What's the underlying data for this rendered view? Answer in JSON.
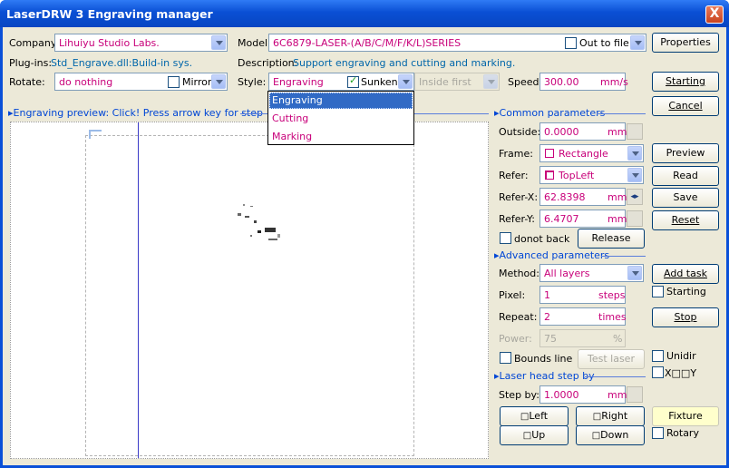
{
  "window": {
    "title": "LaserDRW 3 Engraving manager",
    "close": "X"
  },
  "company": {
    "label": "Company:",
    "value": "Lihuiyu Studio Labs."
  },
  "model": {
    "label": "Model:",
    "value": "6C6879-LASER-(A/B/C/M/F/K/L)SERIES",
    "out_to_file": "Out to file",
    "out_to_file_checked": false
  },
  "plugins": {
    "label": "Plug-ins:",
    "value": "Std_Engrave.dll:Build-in sys."
  },
  "description": {
    "label": "Description:",
    "value": "Support engraving and cutting and marking."
  },
  "rotate": {
    "label": "Rotate:",
    "value": "do nothing",
    "mirror": "Mirror",
    "mirror_checked": false
  },
  "style": {
    "label": "Style:",
    "value": "Engraving",
    "sunken": "Sunken",
    "sunken_checked": true,
    "inside_first": "Inside first",
    "options": [
      "Engraving",
      "Cutting",
      "Marking"
    ],
    "selected": 0
  },
  "speed": {
    "label": "Speed:",
    "value": "300.00",
    "unit": "mm/s"
  },
  "buttons": {
    "properties": "Properties",
    "starting": "Starting",
    "cancel": "Cancel",
    "preview": "Preview",
    "read": "Read",
    "save": "Save",
    "reset": "Reset",
    "release": "Release",
    "add_task": "Add task",
    "stop": "Stop",
    "test_laser": "Test laser",
    "left": "Left",
    "right": "Right",
    "fixture": "Fixture",
    "up": "Up",
    "down": "Down"
  },
  "preview": {
    "label": "Engraving preview: Click! Press arrow key for step"
  },
  "common": {
    "header": "Common parameters",
    "outside_label": "Outside:",
    "outside": "0.0000",
    "outside_unit": "mm",
    "frame_label": "Frame:",
    "frame": "Rectangle",
    "refer_label": "Refer:",
    "refer": "TopLeft",
    "referx_label": "Refer-X:",
    "referx": "62.8398",
    "referx_unit": "mm",
    "refery_label": "Refer-Y:",
    "refery": "6.4707",
    "refery_unit": "mm",
    "donot_back": "donot back"
  },
  "advanced": {
    "header": "Advanced parameters",
    "method_label": "Method:",
    "method": "All layers",
    "pixel_label": "Pixel:",
    "pixel": "1",
    "pixel_unit": "steps",
    "repeat_label": "Repeat:",
    "repeat": "2",
    "repeat_unit": "times",
    "power_label": "Power:",
    "power": "75",
    "power_unit": "%",
    "bounds_line": "Bounds line",
    "starting_chk": "Starting",
    "unidir": "Unidir",
    "xy": "X□□Y"
  },
  "laserhead": {
    "header": "Laser head step by",
    "stepby_label": "Step by:",
    "stepby": "1.0000",
    "stepby_unit": "mm",
    "rotary": "Rotary"
  }
}
